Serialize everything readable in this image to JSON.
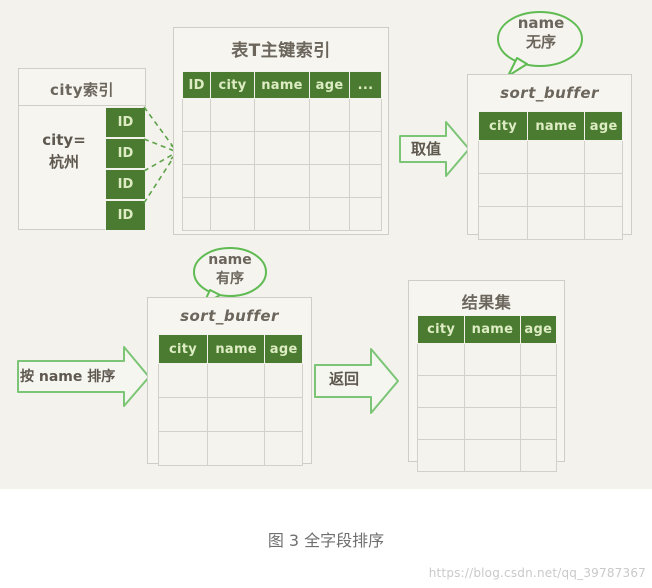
{
  "caption": "图 3 全字段排序",
  "watermark": "https://blog.csdn.net/qq_39787367",
  "colors": {
    "canvas_background": "#f3f2ec",
    "header_green": "#4b7b31",
    "header_text": "#ddecc2",
    "arrow_outline": "#7cc576",
    "box_border": "#cfcec6",
    "text": "#6b655c"
  },
  "city_index": {
    "title": "city索引",
    "filter_label": "city=\n杭州",
    "filter_line1": "city=",
    "filter_line2": "杭州",
    "id_cells": [
      "ID",
      "ID",
      "ID",
      "ID"
    ]
  },
  "primary_index": {
    "title": "表T主键索引",
    "columns": [
      "ID",
      "city",
      "name",
      "age",
      "..."
    ],
    "body_rows": 4
  },
  "sort_buffer_top": {
    "title": "sort_buffer",
    "columns": [
      "city",
      "name",
      "age"
    ],
    "body_rows": 3,
    "callout": {
      "line1": "name",
      "line2": "无序"
    }
  },
  "sort_buffer_bottom": {
    "title": "sort_buffer",
    "columns": [
      "city",
      "name",
      "age"
    ],
    "body_rows": 3,
    "callout": {
      "line1": "name",
      "line2": "有序"
    }
  },
  "result_set": {
    "title": "结果集",
    "columns": [
      "city",
      "name",
      "age"
    ],
    "body_rows": 4
  },
  "arrows": {
    "fetch": "取值",
    "sort_by_name": "按 name 排序",
    "return": "返回"
  }
}
